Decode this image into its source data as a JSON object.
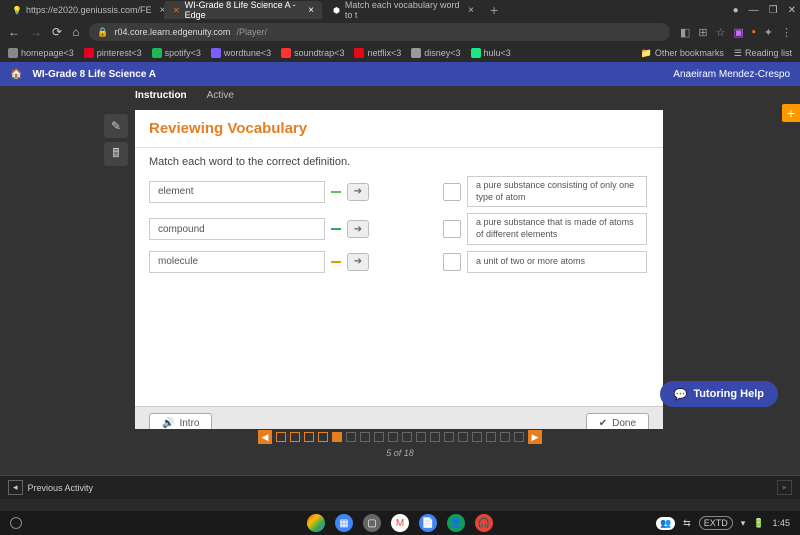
{
  "browser": {
    "tabs": [
      {
        "icon_color": "#fc3",
        "title": "https://e2020.geniussis.com/FE"
      },
      {
        "icon_color": "#f60",
        "title": "WI-Grade 8 Life Science A - Edge"
      },
      {
        "icon_color": "#fff",
        "title": "Match each vocabulary word to t"
      }
    ],
    "url_prefix": "r04.core.learn.edgenuity.com",
    "url_path": "/Player/",
    "bookmarks": [
      {
        "label": "homepage<3",
        "color": "#888"
      },
      {
        "label": "pinterest<3",
        "color": "#e60023"
      },
      {
        "label": "spotify<3",
        "color": "#1db954"
      },
      {
        "label": "wordtune<3",
        "color": "#7b5cff"
      },
      {
        "label": "soundtrap<3",
        "color": "#f33"
      },
      {
        "label": "netflix<3",
        "color": "#e50914"
      },
      {
        "label": "disney<3",
        "color": "#999"
      },
      {
        "label": "hulu<3",
        "color": "#1ce783"
      }
    ],
    "other_bookmarks": "Other bookmarks",
    "reading_list": "Reading list"
  },
  "app": {
    "course_title": "WI-Grade 8 Life Science A",
    "user_name": "Anaeiram Mendez-Crespo"
  },
  "sub_tabs": {
    "instruction": "Instruction",
    "active": "Active"
  },
  "lesson": {
    "title": "Reviewing Vocabulary",
    "instructions": "Match each word to the correct definition.",
    "words": [
      {
        "term": "element"
      },
      {
        "term": "compound"
      },
      {
        "term": "molecule"
      }
    ],
    "definitions": [
      {
        "text": "a pure substance consisting of only one type of atom"
      },
      {
        "text": "a pure substance that is made of atoms of different elements"
      },
      {
        "text": "a unit of two or more atoms"
      }
    ],
    "intro_label": "Intro",
    "done_label": "Done"
  },
  "progress": {
    "page_text": "5 of 18"
  },
  "tutoring": {
    "label": "Tutoring Help"
  },
  "activity_bar": {
    "prev": "Previous Activity"
  },
  "tray": {
    "extd": "EXTD",
    "time": "1:45"
  }
}
